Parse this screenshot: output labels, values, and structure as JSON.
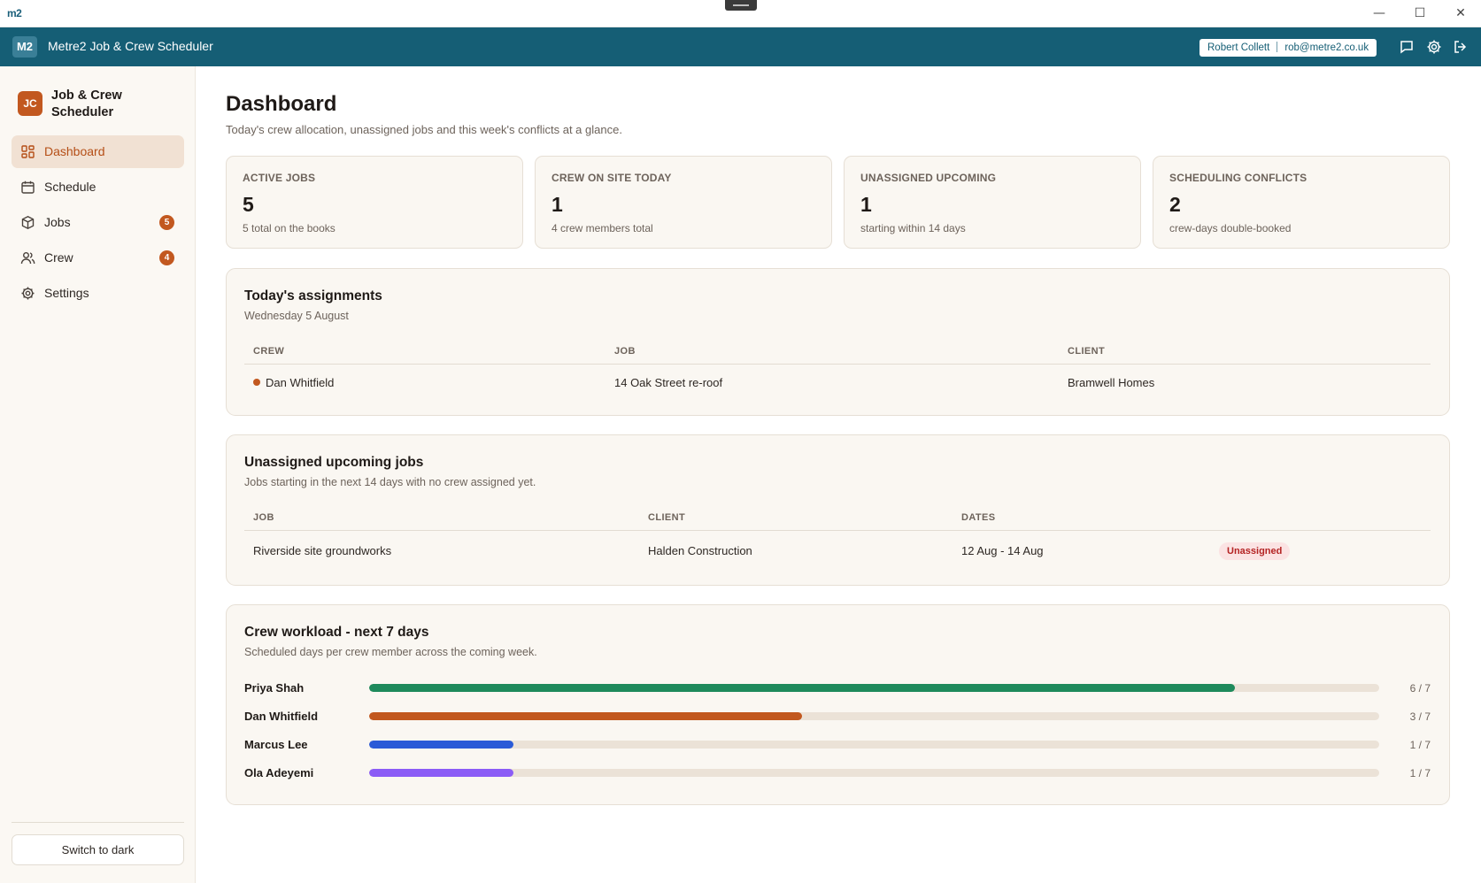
{
  "window": {
    "logo_text": "m2",
    "minimize": "—",
    "maximize": "☐",
    "close": "✕"
  },
  "header": {
    "badge": "M2",
    "app_title": "Metre2 Job & Crew Scheduler",
    "user_name": "Robert Collett",
    "user_email": "rob@metre2.co.uk",
    "icons": [
      "message-icon",
      "gear-icon",
      "logout-icon"
    ]
  },
  "sidebar": {
    "brand_badge": "JC",
    "brand_name": "Job & Crew Scheduler",
    "items": [
      {
        "label": "Dashboard",
        "icon": "dashboard-icon",
        "active": true
      },
      {
        "label": "Schedule",
        "icon": "calendar-icon"
      },
      {
        "label": "Jobs",
        "icon": "box-icon",
        "badge": "5"
      },
      {
        "label": "Crew",
        "icon": "users-icon",
        "badge": "4"
      },
      {
        "label": "Settings",
        "icon": "gear-icon"
      }
    ],
    "theme_button": "Switch to dark"
  },
  "page": {
    "title": "Dashboard",
    "subtitle": "Today's crew allocation, unassigned jobs and this week's conflicts at a glance."
  },
  "stats": [
    {
      "label": "ACTIVE JOBS",
      "value": "5",
      "sub": "5 total on the books"
    },
    {
      "label": "CREW ON SITE TODAY",
      "value": "1",
      "sub": "4 crew members total"
    },
    {
      "label": "UNASSIGNED UPCOMING",
      "value": "1",
      "sub": "starting within 14 days"
    },
    {
      "label": "SCHEDULING CONFLICTS",
      "value": "2",
      "sub": "crew-days double-booked"
    }
  ],
  "today": {
    "title": "Today's assignments",
    "date": "Wednesday 5 August",
    "columns": [
      "CREW",
      "JOB",
      "CLIENT"
    ],
    "rows": [
      {
        "crew": "Dan Whitfield",
        "job": "14 Oak Street re-roof",
        "client": "Bramwell Homes"
      }
    ]
  },
  "unassigned": {
    "title": "Unassigned upcoming jobs",
    "subtitle": "Jobs starting in the next 14 days with no crew assigned yet.",
    "columns": [
      "JOB",
      "CLIENT",
      "DATES"
    ],
    "rows": [
      {
        "job": "Riverside site groundworks",
        "client": "Halden Construction",
        "dates": "12 Aug - 14 Aug",
        "status": "Unassigned"
      }
    ]
  },
  "workload": {
    "title": "Crew workload - next 7 days",
    "subtitle": "Scheduled days per crew member across the coming week.",
    "rows": [
      {
        "name": "Priya Shah",
        "days": 6,
        "total": 7,
        "label": "6 / 7",
        "color": "#1e8a5c"
      },
      {
        "name": "Dan Whitfield",
        "days": 3,
        "total": 7,
        "label": "3 / 7",
        "color": "#c2581f"
      },
      {
        "name": "Marcus Lee",
        "days": 1,
        "total": 7,
        "label": "1 / 7",
        "color": "#2a5bd7"
      },
      {
        "name": "Ola Adeyemi",
        "days": 1,
        "total": 7,
        "label": "1 / 7",
        "color": "#8b5cf6"
      }
    ]
  }
}
